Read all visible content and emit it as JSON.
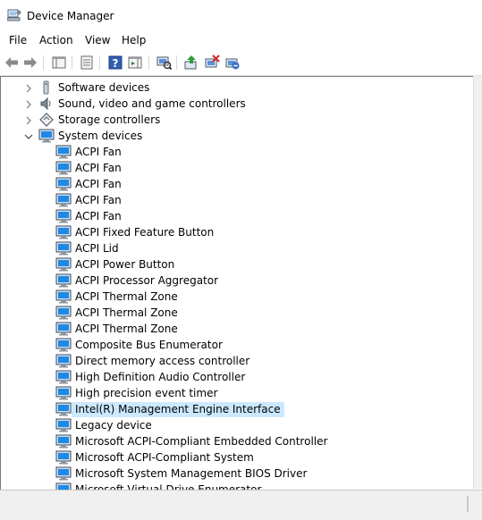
{
  "window": {
    "title": "Device Manager"
  },
  "menu": [
    "File",
    "Action",
    "View",
    "Help"
  ],
  "toolbar": [
    "back-arrow-icon",
    "forward-arrow-icon",
    "show-hide-console-tree-icon",
    "properties-icon",
    "help-icon",
    "show-action-pane-icon",
    "scan-hardware-changes-icon",
    "update-driver-icon",
    "disable-device-icon",
    "uninstall-device-icon"
  ],
  "tree": {
    "categories": [
      {
        "label": "Software devices",
        "icon": "software-device-icon",
        "expanded": false
      },
      {
        "label": "Sound, video and game controllers",
        "icon": "speaker-icon",
        "expanded": false
      },
      {
        "label": "Storage controllers",
        "icon": "storage-controller-icon",
        "expanded": false
      },
      {
        "label": "System devices",
        "icon": "monitor-icon",
        "expanded": true
      }
    ],
    "system_devices": [
      "ACPI Fan",
      "ACPI Fan",
      "ACPI Fan",
      "ACPI Fan",
      "ACPI Fan",
      "ACPI Fixed Feature Button",
      "ACPI Lid",
      "ACPI Power Button",
      "ACPI Processor Aggregator",
      "ACPI Thermal Zone",
      "ACPI Thermal Zone",
      "ACPI Thermal Zone",
      "Composite Bus Enumerator",
      "Direct memory access controller",
      "High Definition Audio Controller",
      "High precision event timer",
      "Intel(R) Management Engine Interface",
      "Legacy device",
      "Microsoft ACPI-Compliant Embedded Controller",
      "Microsoft ACPI-Compliant System",
      "Microsoft System Management BIOS Driver",
      "Microsoft Virtual Drive Enumerator"
    ],
    "selected_device": "Intel(R) Management Engine Interface"
  },
  "colors": {
    "selection": "#cce8ff",
    "monitor": "#1e88e5"
  }
}
